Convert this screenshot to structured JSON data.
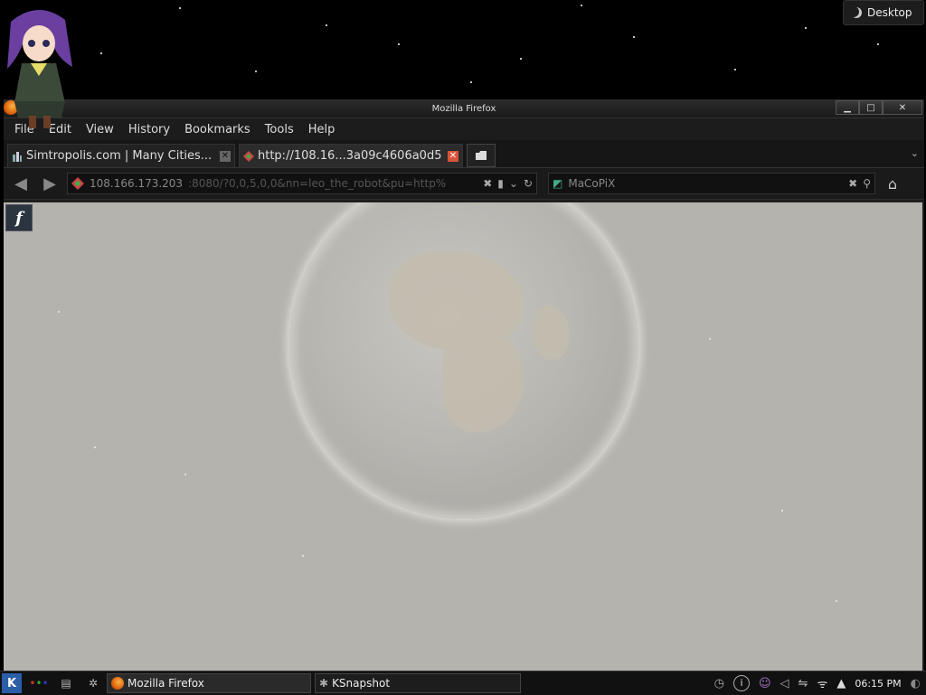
{
  "desktop": {
    "button_label": "Desktop"
  },
  "window": {
    "title": "Mozilla Firefox",
    "controls": {
      "minimize": "▁",
      "maximize": "□",
      "close": "✕"
    }
  },
  "menubar": {
    "items": [
      "File",
      "Edit",
      "View",
      "History",
      "Bookmarks",
      "Tools",
      "Help"
    ]
  },
  "tabs": [
    {
      "label": "Simtropolis.com | Many Cities...",
      "active": false
    },
    {
      "label": "http://108.16...3a09c4606a0d5",
      "active": true
    }
  ],
  "urlbar": {
    "host": "108.166.173.203",
    "rest": ":8080/?0,0,5,0,0&nn=leo_the_robot&pu=http%"
  },
  "searchbar": {
    "value": "MaCoPiX"
  },
  "taskbar": {
    "tasks": [
      {
        "label": "Mozilla Firefox",
        "active": true
      },
      {
        "label": "KSnapshot",
        "active": false
      }
    ],
    "clock": "06:15 PM"
  },
  "colors": {
    "content_bg": "#b5b3ae",
    "active_tab_close": "#d9533b"
  },
  "icons": [
    "firefox-icon",
    "back-arrow-icon",
    "forward-arrow-icon",
    "reload-icon",
    "home-icon",
    "search-icon",
    "flash-plugin-icon",
    "kde-menu-icon",
    "wifi-icon",
    "volume-icon",
    "usb-icon"
  ]
}
